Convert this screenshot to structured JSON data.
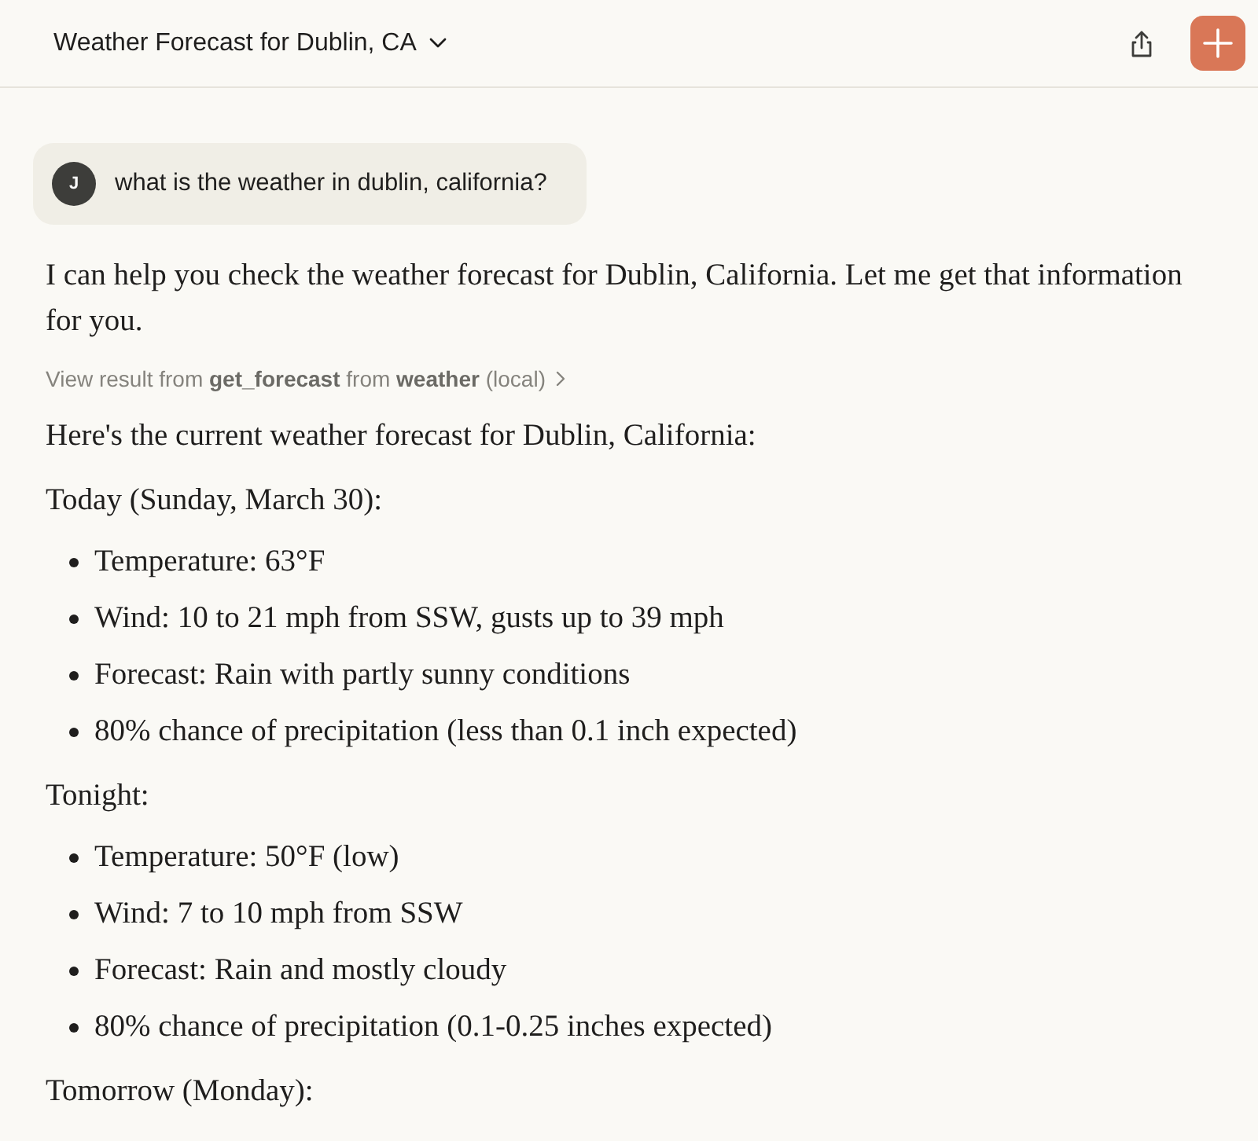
{
  "header": {
    "title": "Weather Forecast for Dublin, CA"
  },
  "user_message": {
    "avatar_letter": "J",
    "text": "what is the weather in dublin, california?"
  },
  "assistant_message": {
    "intro": "I can help you check the weather forecast for Dublin, California. Let me get that information for you.",
    "tool_result": "View result from **get_forecast** from **weather** (local)",
    "blocks": [
      {
        "kind": "paragraph",
        "text": "Here's the current weather forecast for Dublin, California:"
      },
      {
        "kind": "paragraph",
        "text": "Today (Sunday, March 30):"
      },
      {
        "kind": "list",
        "items": [
          "Temperature: 63°F",
          "Wind: 10 to 21 mph from SSW, gusts up to 39 mph",
          "Forecast: Rain with partly sunny conditions",
          "80% chance of precipitation (less than 0.1 inch expected)"
        ]
      },
      {
        "kind": "paragraph",
        "text": "Tonight:"
      },
      {
        "kind": "list",
        "items": [
          "Temperature: 50°F (low)",
          "Wind: 7 to 10 mph from SSW",
          "Forecast: Rain and mostly cloudy",
          "80% chance of precipitation (0.1-0.25 inches expected)"
        ]
      },
      {
        "kind": "paragraph",
        "text": "Tomorrow (Monday):"
      }
    ]
  }
}
